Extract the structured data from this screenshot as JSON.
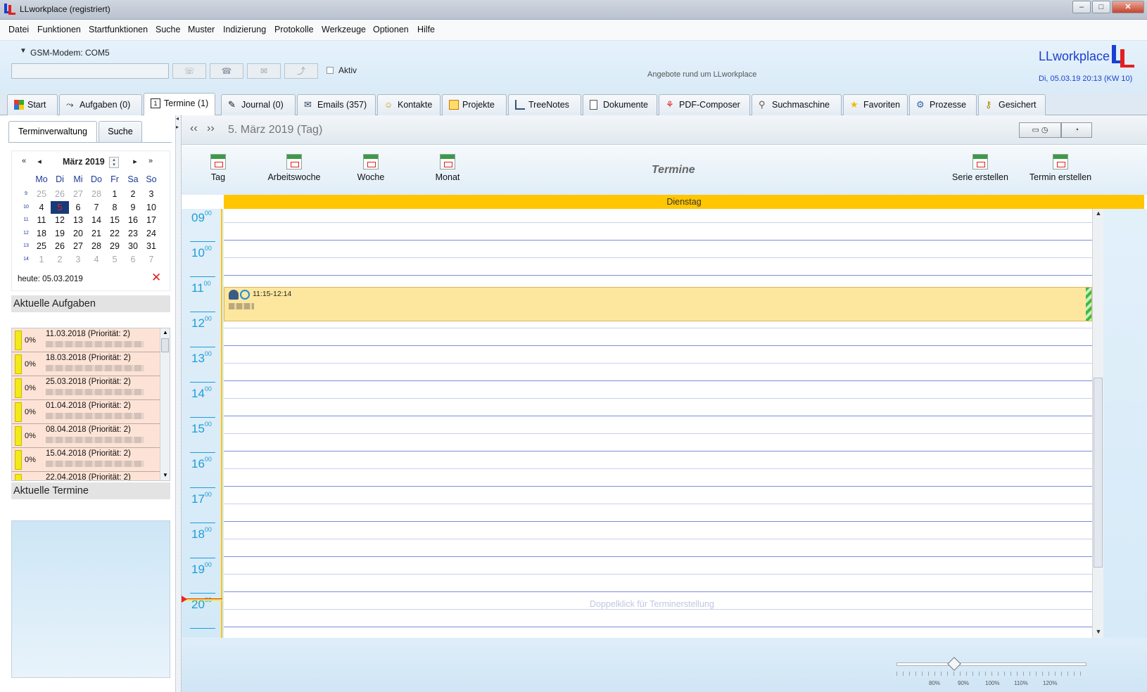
{
  "window": {
    "title": "LLworkplace (registriert)",
    "minimize": "–",
    "maximize": "□",
    "close": "✕"
  },
  "menu": [
    "Datei",
    "Funktionen",
    "Startfunktionen",
    "Suche",
    "Muster",
    "Indizierung",
    "Protokolle",
    "Werkzeuge",
    "Optionen",
    "Hilfe"
  ],
  "toolbar": {
    "modem_label": "GSM-Modem: COM5",
    "modem_input": "",
    "aktiv_label": "Aktiv",
    "aktiv_checked": false,
    "tagline": "Angebote rund um LLworkplace",
    "brand": "LLworkplace",
    "datetime": "Di, 05.03.19 20:13 (KW 10)"
  },
  "tabs": [
    {
      "label": "Start",
      "icon": "windows-icon"
    },
    {
      "label": "Aufgaben (0)",
      "icon": "arrow-icon"
    },
    {
      "label": "Termine (1)",
      "icon": "calendar-icon",
      "active": true
    },
    {
      "label": "Journal (0)",
      "icon": "pen-icon"
    },
    {
      "label": "Emails (357)",
      "icon": "email-icon"
    },
    {
      "label": "Kontakte",
      "icon": "contact-icon"
    },
    {
      "label": "Projekte",
      "icon": "project-icon"
    },
    {
      "label": "TreeNotes",
      "icon": "tree-icon"
    },
    {
      "label": "Dokumente",
      "icon": "document-icon"
    },
    {
      "label": "PDF-Composer",
      "icon": "pdf-icon"
    },
    {
      "label": "Suchmaschine",
      "icon": "search-icon"
    },
    {
      "label": "Favoriten",
      "icon": "star-icon"
    },
    {
      "label": "Prozesse",
      "icon": "gear-icon"
    },
    {
      "label": "Gesichert",
      "icon": "key-icon"
    }
  ],
  "left": {
    "subtabs": [
      "Terminverwaltung",
      "Suche"
    ],
    "calendar": {
      "month_label": "März 2019",
      "weekday_headers": [
        "Mo",
        "Di",
        "Mi",
        "Do",
        "Fr",
        "Sa",
        "So"
      ],
      "weeks": [
        {
          "kw": "9",
          "days": [
            "25",
            "26",
            "27",
            "28",
            "1",
            "2",
            "3"
          ],
          "other": [
            true,
            true,
            true,
            true,
            false,
            false,
            false
          ]
        },
        {
          "kw": "10",
          "days": [
            "4",
            "5",
            "6",
            "7",
            "8",
            "9",
            "10"
          ],
          "other": [
            false,
            false,
            false,
            false,
            false,
            false,
            false
          ]
        },
        {
          "kw": "11",
          "days": [
            "11",
            "12",
            "13",
            "14",
            "15",
            "16",
            "17"
          ],
          "other": [
            false,
            false,
            false,
            false,
            false,
            false,
            false
          ]
        },
        {
          "kw": "12",
          "days": [
            "18",
            "19",
            "20",
            "21",
            "22",
            "23",
            "24"
          ],
          "other": [
            false,
            false,
            false,
            false,
            false,
            false,
            false
          ]
        },
        {
          "kw": "13",
          "days": [
            "25",
            "26",
            "27",
            "28",
            "29",
            "30",
            "31"
          ],
          "other": [
            false,
            false,
            false,
            false,
            false,
            false,
            false
          ]
        },
        {
          "kw": "14",
          "days": [
            "1",
            "2",
            "3",
            "4",
            "5",
            "6",
            "7"
          ],
          "other": [
            true,
            true,
            true,
            true,
            true,
            true,
            true
          ]
        }
      ],
      "selected_day": "5",
      "today_label": "heute: 05.03.2019"
    },
    "tasks_title": "Aktuelle Aufgaben",
    "tasks": [
      {
        "pct": "0%",
        "date": "11.03.2018 (Priorität: 2)"
      },
      {
        "pct": "0%",
        "date": "18.03.2018 (Priorität: 2)"
      },
      {
        "pct": "0%",
        "date": "25.03.2018 (Priorität: 2)"
      },
      {
        "pct": "0%",
        "date": "01.04.2018 (Priorität: 2)"
      },
      {
        "pct": "0%",
        "date": "08.04.2018 (Priorität: 2)"
      },
      {
        "pct": "0%",
        "date": "15.04.2018 (Priorität: 2)"
      },
      {
        "pct": "0%",
        "date": "22.04.2018 (Priorität: 2)"
      }
    ],
    "termine_title": "Aktuelle Termine"
  },
  "main": {
    "date_label": "5. März 2019 (Tag)",
    "views": [
      "Tag",
      "Arbeitswoche",
      "Woche",
      "Monat"
    ],
    "view_title": "Termine",
    "actions": [
      "Serie erstellen",
      "Termin erstellen"
    ],
    "day_header": "Dienstag",
    "hours": [
      "09",
      "10",
      "11",
      "12",
      "13",
      "14",
      "15",
      "16",
      "17",
      "18",
      "19",
      "20"
    ],
    "hour_suffix": "00",
    "event": {
      "time": "11:15-12:14"
    },
    "hint": "Doppelklick für Terminerstellung",
    "zoom_labels": [
      "80%",
      "90%",
      "100%",
      "110%",
      "120%"
    ],
    "zoom_value": "90%"
  },
  "colors": {
    "accent": "#1b3fd1",
    "day_header": "#ffc601",
    "hour_label": "#1e9dd8",
    "event": "#fde79e",
    "task_bg": "#fde3d6"
  }
}
